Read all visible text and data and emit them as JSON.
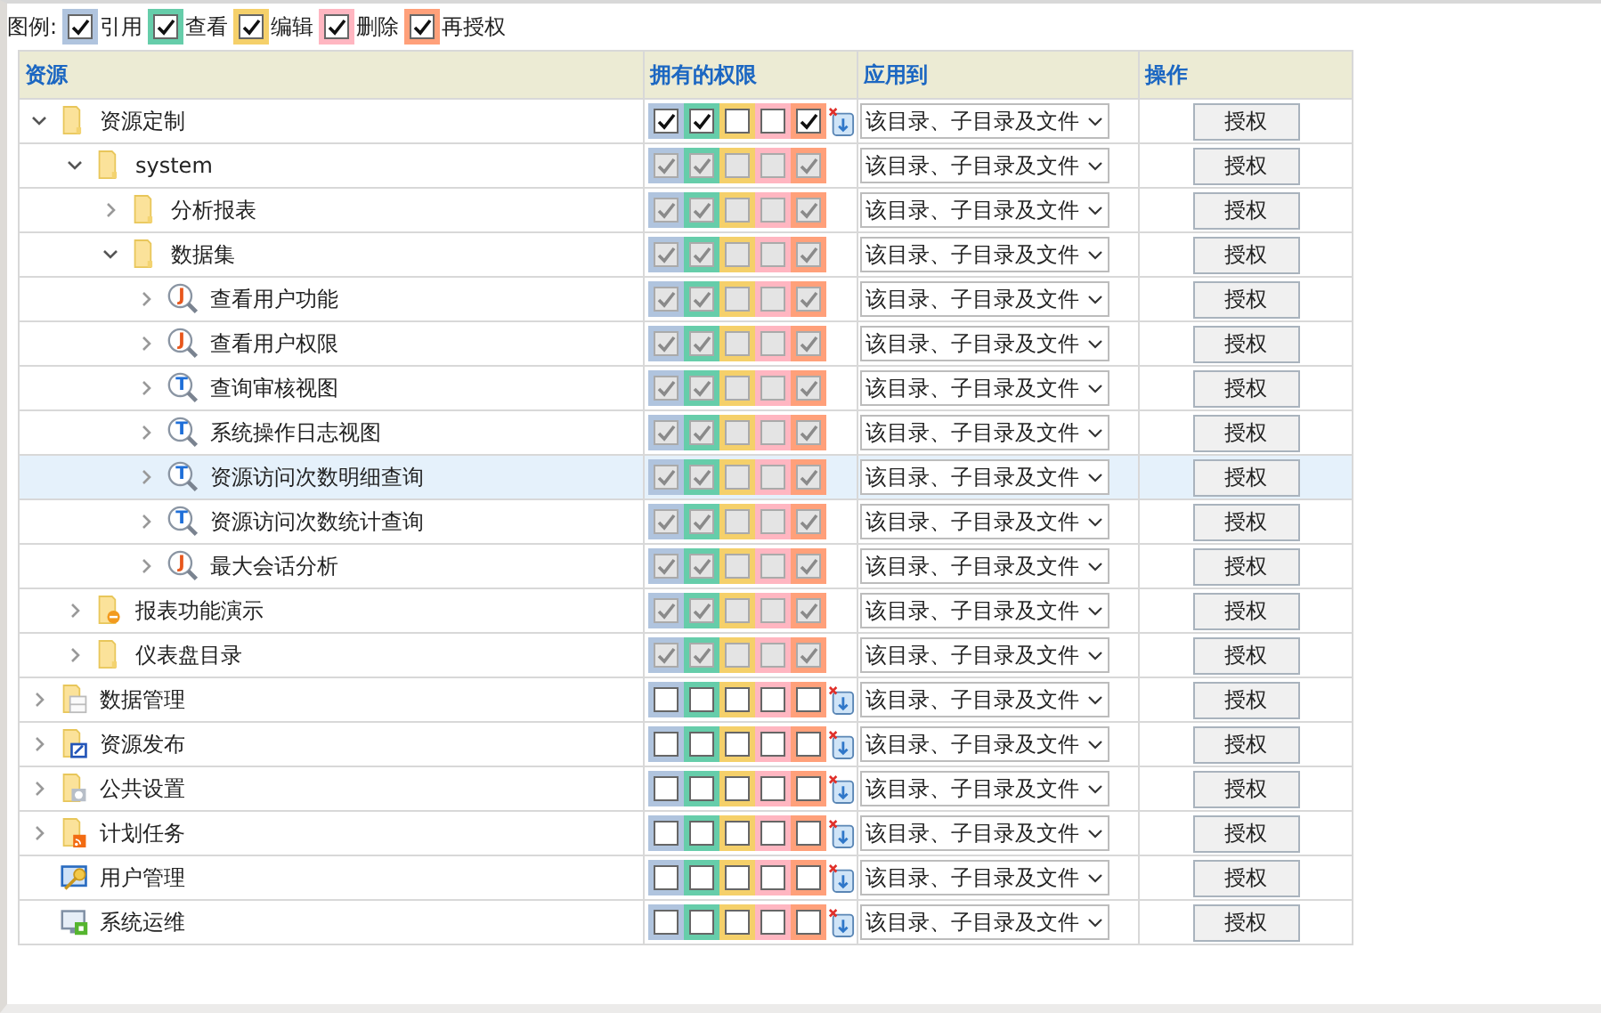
{
  "legend": {
    "label": "图例:",
    "items": [
      {
        "label": "引用",
        "checked": true
      },
      {
        "label": "查看",
        "checked": true
      },
      {
        "label": "编辑",
        "checked": true
      },
      {
        "label": "删除",
        "checked": true
      },
      {
        "label": "再授权",
        "checked": true
      }
    ]
  },
  "table": {
    "columns": [
      "资源",
      "拥有的权限",
      "应用到",
      "操作"
    ],
    "rows": [
      {
        "label": "资源定制",
        "kind": "folder",
        "expandable": true,
        "expanded": true,
        "selected": false,
        "disabled": false,
        "perms": [
          true,
          true,
          false,
          false,
          true
        ],
        "apply": "该目录、子目录及文件",
        "action": "授权",
        "children": [
          {
            "label": "system",
            "kind": "folder",
            "expandable": true,
            "expanded": true,
            "selected": false,
            "disabled": true,
            "perms": [
              true,
              true,
              false,
              false,
              true
            ],
            "apply": "该目录、子目录及文件",
            "action": "授权",
            "children": [
              {
                "label": "分析报表",
                "kind": "folder",
                "expandable": true,
                "expanded": false,
                "selected": false,
                "disabled": true,
                "perms": [
                  true,
                  true,
                  false,
                  false,
                  true
                ],
                "apply": "该目录、子目录及文件",
                "action": "授权"
              },
              {
                "label": "数据集",
                "kind": "folder",
                "expandable": true,
                "expanded": true,
                "selected": false,
                "disabled": true,
                "perms": [
                  true,
                  true,
                  false,
                  false,
                  true
                ],
                "apply": "该目录、子目录及文件",
                "action": "授权",
                "children": [
                  {
                    "label": "查看用户功能",
                    "kind": "jquery",
                    "badge": "J",
                    "expandable": true,
                    "expanded": false,
                    "selected": false,
                    "disabled": true,
                    "perms": [
                      true,
                      true,
                      false,
                      false,
                      true
                    ],
                    "apply": "该目录、子目录及文件",
                    "action": "授权"
                  },
                  {
                    "label": "查看用户权限",
                    "kind": "jquery",
                    "badge": "J",
                    "expandable": true,
                    "expanded": false,
                    "selected": false,
                    "disabled": true,
                    "perms": [
                      true,
                      true,
                      false,
                      false,
                      true
                    ],
                    "apply": "该目录、子目录及文件",
                    "action": "授权"
                  },
                  {
                    "label": "查询审核视图",
                    "kind": "tquery",
                    "badge": "T",
                    "expandable": true,
                    "expanded": false,
                    "selected": false,
                    "disabled": true,
                    "perms": [
                      true,
                      true,
                      false,
                      false,
                      true
                    ],
                    "apply": "该目录、子目录及文件",
                    "action": "授权"
                  },
                  {
                    "label": "系统操作日志视图",
                    "kind": "tquery",
                    "badge": "T",
                    "expandable": true,
                    "expanded": false,
                    "selected": false,
                    "disabled": true,
                    "perms": [
                      true,
                      true,
                      false,
                      false,
                      true
                    ],
                    "apply": "该目录、子目录及文件",
                    "action": "授权"
                  },
                  {
                    "label": "资源访问次数明细查询",
                    "kind": "tquery",
                    "badge": "T",
                    "expandable": true,
                    "expanded": false,
                    "selected": true,
                    "disabled": true,
                    "perms": [
                      true,
                      true,
                      false,
                      false,
                      true
                    ],
                    "apply": "该目录、子目录及文件",
                    "action": "授权"
                  },
                  {
                    "label": "资源访问次数统计查询",
                    "kind": "tquery",
                    "badge": "T",
                    "expandable": true,
                    "expanded": false,
                    "selected": false,
                    "disabled": true,
                    "perms": [
                      true,
                      true,
                      false,
                      false,
                      true
                    ],
                    "apply": "该目录、子目录及文件",
                    "action": "授权"
                  },
                  {
                    "label": "最大会话分析",
                    "kind": "jquery",
                    "badge": "J",
                    "expandable": true,
                    "expanded": false,
                    "selected": false,
                    "disabled": true,
                    "perms": [
                      true,
                      true,
                      false,
                      false,
                      true
                    ],
                    "apply": "该目录、子目录及文件",
                    "action": "授权"
                  }
                ]
              }
            ]
          },
          {
            "label": "报表功能演示",
            "kind": "report",
            "expandable": true,
            "expanded": false,
            "selected": false,
            "disabled": true,
            "perms": [
              true,
              true,
              false,
              false,
              true
            ],
            "apply": "该目录、子目录及文件",
            "action": "授权"
          },
          {
            "label": "仪表盘目录",
            "kind": "folder",
            "expandable": true,
            "expanded": false,
            "selected": false,
            "disabled": true,
            "perms": [
              true,
              true,
              false,
              false,
              true
            ],
            "apply": "该目录、子目录及文件",
            "action": "授权"
          }
        ]
      },
      {
        "label": "数据管理",
        "kind": "data",
        "expandable": true,
        "expanded": false,
        "selected": false,
        "disabled": false,
        "perms": [
          false,
          false,
          false,
          false,
          false
        ],
        "apply": "该目录、子目录及文件",
        "action": "授权"
      },
      {
        "label": "资源发布",
        "kind": "publish",
        "expandable": true,
        "expanded": false,
        "selected": false,
        "disabled": false,
        "perms": [
          false,
          false,
          false,
          false,
          false
        ],
        "apply": "该目录、子目录及文件",
        "action": "授权"
      },
      {
        "label": "公共设置",
        "kind": "settings",
        "expandable": true,
        "expanded": false,
        "selected": false,
        "disabled": false,
        "perms": [
          false,
          false,
          false,
          false,
          false
        ],
        "apply": "该目录、子目录及文件",
        "action": "授权"
      },
      {
        "label": "计划任务",
        "kind": "feed",
        "expandable": true,
        "expanded": false,
        "selected": false,
        "disabled": false,
        "perms": [
          false,
          false,
          false,
          false,
          false
        ],
        "apply": "该目录、子目录及文件",
        "action": "授权"
      },
      {
        "label": "用户管理",
        "kind": "admin",
        "expandable": false,
        "selected": false,
        "disabled": false,
        "perms": [
          false,
          false,
          false,
          false,
          false
        ],
        "apply": "该目录、子目录及文件",
        "action": "授权"
      },
      {
        "label": "系统运维",
        "kind": "monitor",
        "expandable": false,
        "selected": false,
        "disabled": false,
        "perms": [
          false,
          false,
          false,
          false,
          false
        ],
        "apply": "该目录、子目录及文件",
        "action": "授权"
      }
    ]
  }
}
